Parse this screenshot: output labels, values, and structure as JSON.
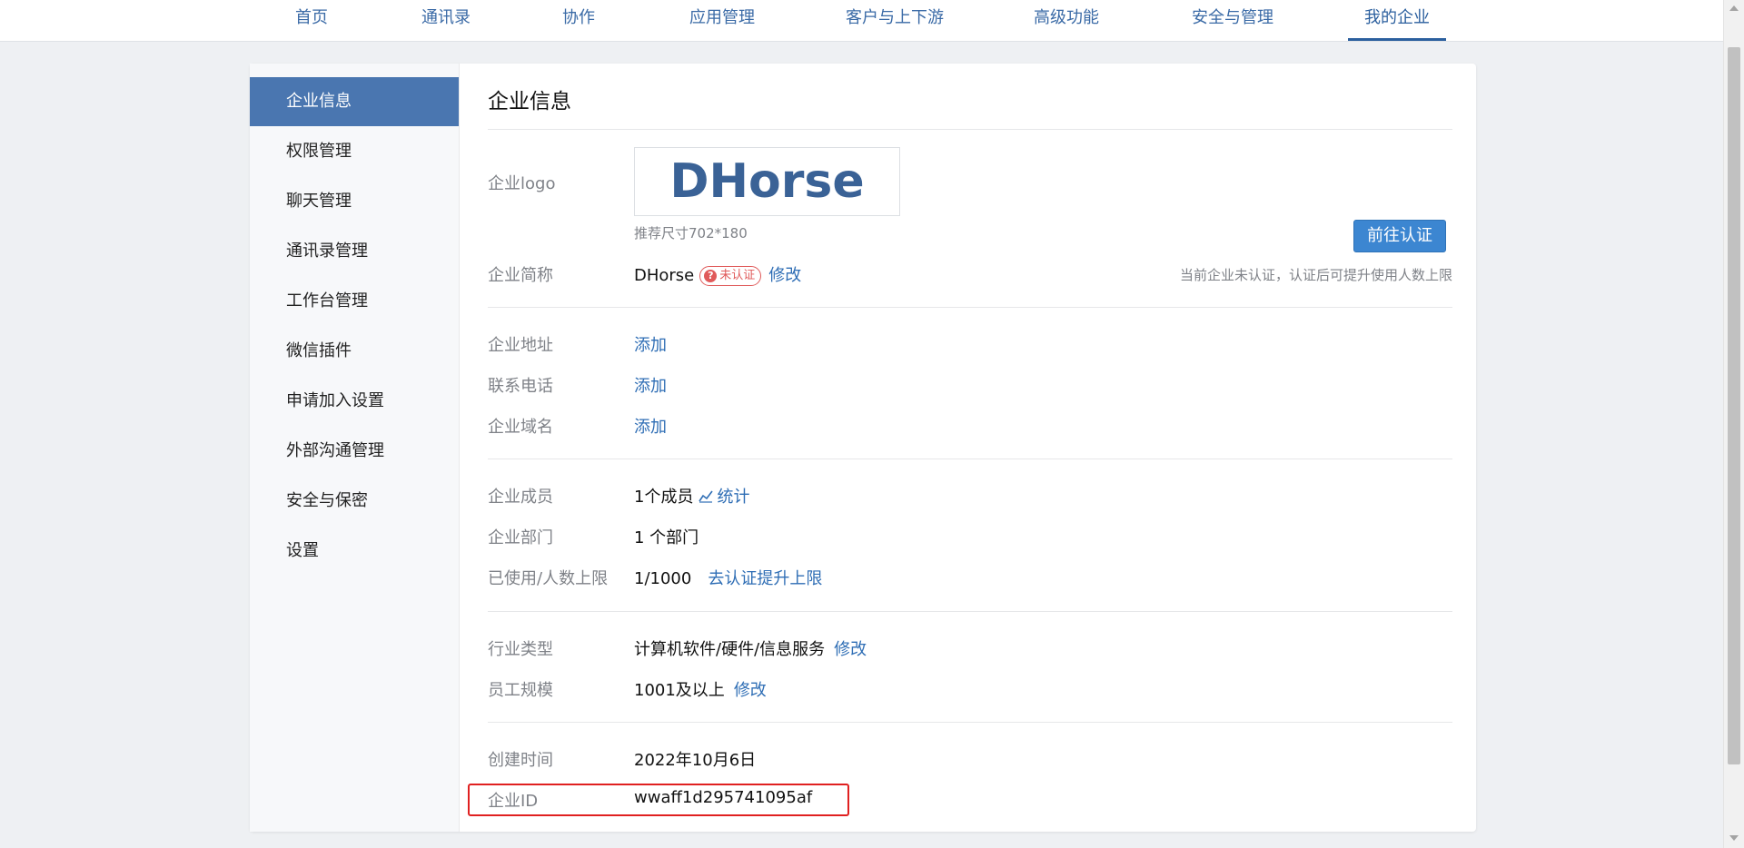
{
  "nav": {
    "items": [
      "首页",
      "通讯录",
      "协作",
      "应用管理",
      "客户与上下游",
      "高级功能",
      "安全与管理",
      "我的企业"
    ],
    "active_index": 7
  },
  "sidebar": {
    "items": [
      "企业信息",
      "权限管理",
      "聊天管理",
      "通讯录管理",
      "工作台管理",
      "微信插件",
      "申请加入设置",
      "外部沟通管理",
      "安全与保密",
      "设置"
    ],
    "active_index": 0
  },
  "page": {
    "title": "企业信息",
    "logo": {
      "label": "企业logo",
      "logo_text": "DHorse",
      "hint": "推荐尺寸702*180"
    },
    "short_name": {
      "label": "企业简称",
      "value": "DHorse",
      "badge": "未认证",
      "badge_icon": "?",
      "edit": "修改"
    },
    "verify": {
      "button": "前往认证",
      "note": "当前企业未认证，认证后可提升使用人数上限"
    },
    "address": {
      "label": "企业地址",
      "action": "添加"
    },
    "phone": {
      "label": "联系电话",
      "action": "添加"
    },
    "domain": {
      "label": "企业域名",
      "action": "添加"
    },
    "members": {
      "label": "企业成员",
      "value": "1个成员",
      "link": "统计"
    },
    "departments": {
      "label": "企业部门",
      "value": "1 个部门"
    },
    "usage": {
      "label": "已使用/人数上限",
      "value": "1/1000",
      "link": "去认证提升上限"
    },
    "industry": {
      "label": "行业类型",
      "value": "计算机软件/硬件/信息服务",
      "edit": "修改"
    },
    "scale": {
      "label": "员工规模",
      "value": "1001及以上",
      "edit": "修改"
    },
    "created": {
      "label": "创建时间",
      "value": "2022年10月6日"
    },
    "corp_id": {
      "label": "企业ID",
      "value": "wwaff1d295741095af"
    }
  },
  "colors": {
    "accent": "#4a76b0",
    "link": "#2f6eb5",
    "badge": "#e05a5a",
    "highlight": "#e02020"
  }
}
